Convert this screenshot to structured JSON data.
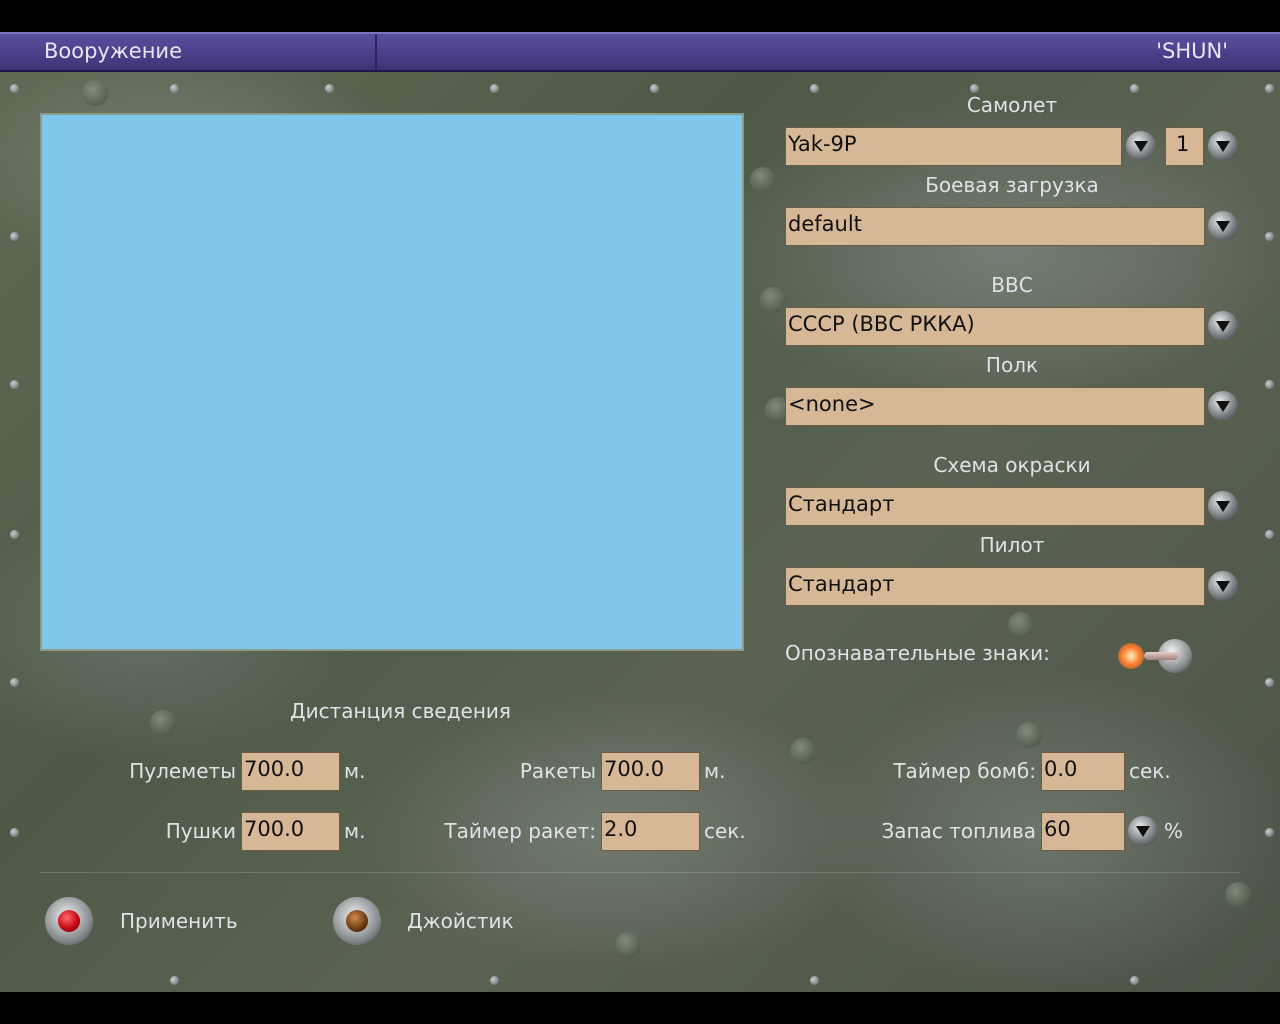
{
  "titlebar": {
    "left": "Вооружение",
    "right": "'SHUN'"
  },
  "aircraft": {
    "label": "Самолет",
    "value": "Yak-9P",
    "count": "1"
  },
  "loadout": {
    "label": "Боевая загрузка",
    "value": "default"
  },
  "airforce": {
    "label": "ВВС",
    "value": "СССР (ВВС РККА)"
  },
  "regiment": {
    "label": "Полк",
    "value": "<none>"
  },
  "skin": {
    "label": "Схема окраски",
    "value": "Стандарт"
  },
  "pilot": {
    "label": "Пилот",
    "value": "Стандарт"
  },
  "markings": {
    "label": "Опознавательные знаки:"
  },
  "convergence": {
    "title": "Дистанция сведения",
    "mg_label": "Пулеметы",
    "mg_value": "700.0",
    "mg_unit": "м.",
    "cannon_label": "Пушки",
    "cannon_value": "700.0",
    "cannon_unit": "м.",
    "rockets_label": "Ракеты",
    "rockets_value": "700.0",
    "rockets_unit": "м.",
    "rocket_timer_label": "Таймер ракет:",
    "rocket_timer_value": "2.0",
    "rocket_timer_unit": "сек.",
    "bomb_timer_label": "Таймер бомб:",
    "bomb_timer_value": "0.0",
    "bomb_timer_unit": "сек.",
    "fuel_label": "Запас топлива",
    "fuel_value": "60",
    "fuel_unit": "%"
  },
  "buttons": {
    "apply": "Применить",
    "joystick": "Джойстик"
  },
  "colors": {
    "titlebar": "#4a4190",
    "field": "#d6b796",
    "preview": "#7fc8ec"
  }
}
